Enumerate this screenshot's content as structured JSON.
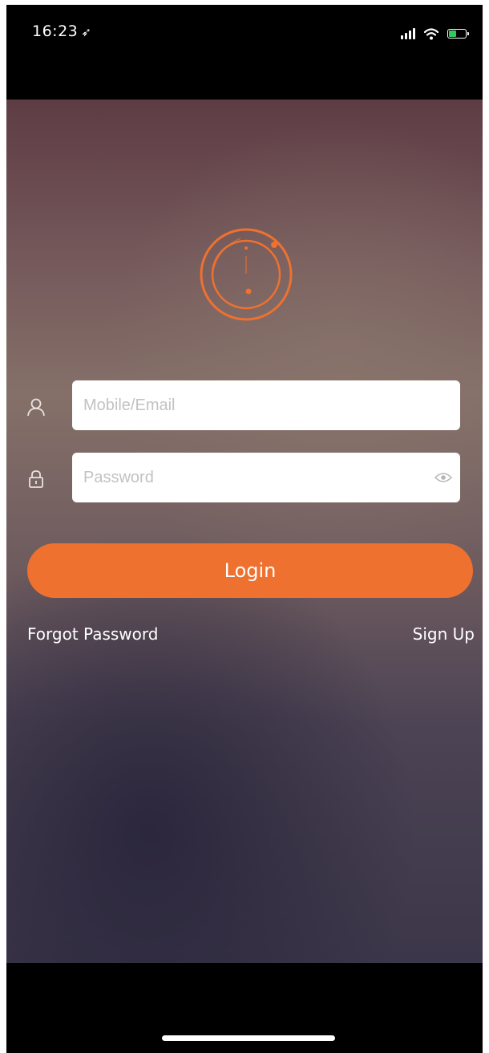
{
  "status_bar": {
    "time": "16:23",
    "location_icon": "location-arrow-icon",
    "signal_icon": "cellular-signal-icon",
    "wifi_icon": "wifi-icon",
    "battery_icon": "battery-icon",
    "battery_color": "#34c759"
  },
  "login": {
    "logo_icon": "orbit-ring-logo",
    "accent_color": "#ee7130",
    "username": {
      "icon": "user-icon",
      "placeholder": "Mobile/Email",
      "value": ""
    },
    "password": {
      "icon": "lock-icon",
      "placeholder": "Password",
      "value": "",
      "toggle_icon": "eye-icon"
    },
    "login_label": "Login",
    "forgot_label": "Forgot Password",
    "signup_label": "Sign Up"
  }
}
